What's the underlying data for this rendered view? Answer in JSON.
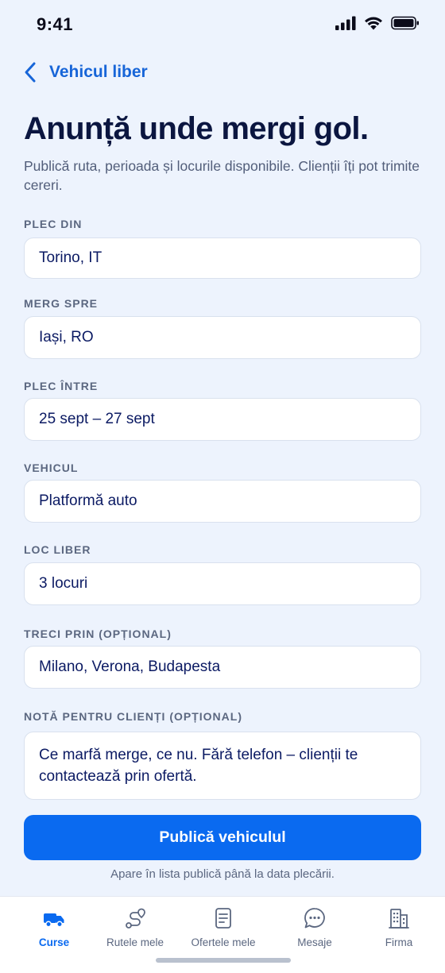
{
  "status_bar": {
    "time": "9:41"
  },
  "nav": {
    "back_label": "Vehicul liber"
  },
  "header": {
    "title": "Anunță unde mergi gol.",
    "subtitle": "Publică ruta, perioada și locurile disponibile. Clienții îți pot trimite cereri."
  },
  "form": {
    "from": {
      "label": "PLEC DIN",
      "value": "Torino, IT"
    },
    "to": {
      "label": "MERG SPRE",
      "value": "Iași, RO"
    },
    "dates": {
      "label": "PLEC ÎNTRE",
      "value": "25 sept – 27 sept"
    },
    "vehicle": {
      "label": "VEHICUL",
      "value": "Platformă auto"
    },
    "capacity": {
      "label": "LOC LIBER",
      "value": "3 locuri"
    },
    "via": {
      "label": "TRECI PRIN (OPȚIONAL)",
      "value": "Milano, Verona, Budapesta"
    },
    "note": {
      "label": "NOTĂ PENTRU CLIENȚI (OPȚIONAL)",
      "value": "Ce marfă merge, ce nu. Fără telefon – clienții te contactează prin ofertă."
    }
  },
  "actions": {
    "publish_label": "Publică vehiculul",
    "publish_note": "Apare în lista publică până la data plecării."
  },
  "tabs": [
    {
      "label": "Curse",
      "icon": "truck-icon",
      "active": true
    },
    {
      "label": "Rutele mele",
      "icon": "route-icon",
      "active": false
    },
    {
      "label": "Ofertele mele",
      "icon": "document-icon",
      "active": false
    },
    {
      "label": "Mesaje",
      "icon": "chat-icon",
      "active": false
    },
    {
      "label": "Firma",
      "icon": "building-icon",
      "active": false
    }
  ],
  "colors": {
    "accent": "#0A6AF0",
    "background": "#EDF3FD",
    "title": "#0B1640",
    "field_text": "#0B1A63",
    "label": "#5B6780"
  }
}
